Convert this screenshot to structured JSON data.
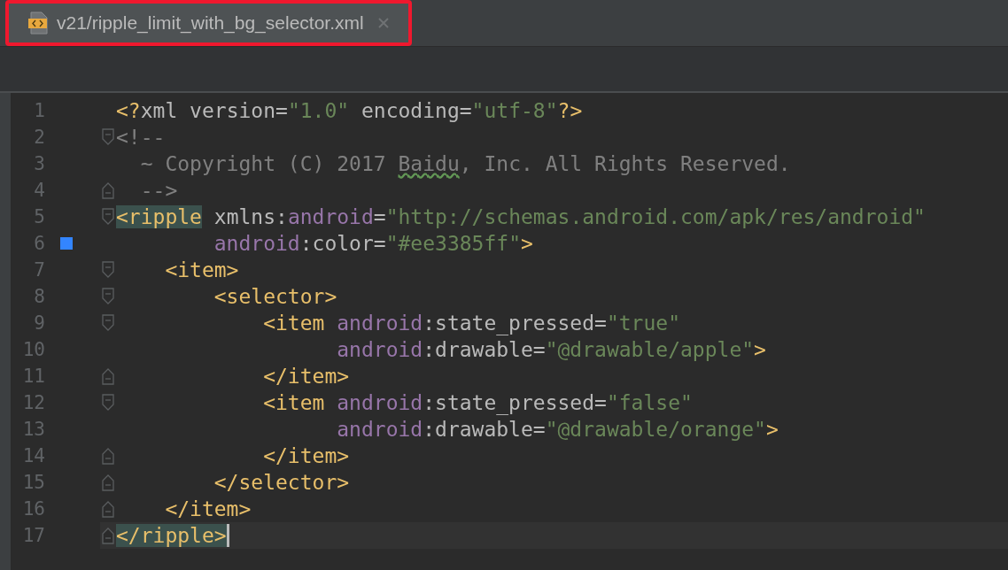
{
  "tabs": [
    {
      "label": "v21/ripple_limit_with_bg_selector.xml",
      "selected": true
    }
  ],
  "lines": [
    {
      "number": "1",
      "fold_start": false,
      "fold_end": false,
      "tokens": [
        {
          "kind": "tag",
          "text": "<?"
        },
        {
          "kind": "attr",
          "text": "xml version="
        },
        {
          "kind": "value",
          "text": "\"1.0\""
        },
        {
          "kind": "attr",
          "text": " encoding="
        },
        {
          "kind": "value",
          "text": "\"utf-8\""
        },
        {
          "kind": "tag",
          "text": "?>"
        }
      ]
    },
    {
      "number": "2",
      "fold_start": true,
      "fold_end": false,
      "tokens": [
        {
          "kind": "comment",
          "text": "<!--"
        }
      ]
    },
    {
      "number": "3",
      "fold_start": false,
      "fold_end": false,
      "tokens": [
        {
          "kind": "comment",
          "text": "  ~ Copyright (C) 2017 "
        },
        {
          "kind": "comment",
          "text": "Baidu",
          "misspelled": true
        },
        {
          "kind": "comment",
          "text": ", Inc. All Rights Reserved."
        }
      ]
    },
    {
      "number": "4",
      "fold_start": false,
      "fold_end": true,
      "tokens": [
        {
          "kind": "comment",
          "text": "  -->"
        }
      ]
    },
    {
      "number": "5",
      "fold_start": true,
      "fold_end": false,
      "tokens": [
        {
          "kind": "tag",
          "text": "<ripple",
          "matched": true
        },
        {
          "kind": "attr",
          "text": " xmlns:"
        },
        {
          "kind": "ns",
          "text": "android"
        },
        {
          "kind": "attr",
          "text": "="
        },
        {
          "kind": "value",
          "text": "\"http://schemas.android.com/apk/res/android\""
        }
      ]
    },
    {
      "number": "6",
      "fold_start": false,
      "fold_end": false,
      "color": "#3385ff",
      "tokens": [
        {
          "kind": "ns",
          "text": "        android"
        },
        {
          "kind": "attr",
          "text": ":color="
        },
        {
          "kind": "value",
          "text": "\"#ee3385ff\""
        },
        {
          "kind": "tag",
          "text": ">"
        }
      ]
    },
    {
      "number": "7",
      "fold_start": true,
      "fold_end": false,
      "tokens": [
        {
          "kind": "tag",
          "text": "    <item>"
        }
      ]
    },
    {
      "number": "8",
      "fold_start": true,
      "fold_end": false,
      "tokens": [
        {
          "kind": "tag",
          "text": "        <selector>"
        }
      ]
    },
    {
      "number": "9",
      "fold_start": true,
      "fold_end": false,
      "tokens": [
        {
          "kind": "tag",
          "text": "            <item "
        },
        {
          "kind": "ns",
          "text": "android"
        },
        {
          "kind": "attr",
          "text": ":state_pressed="
        },
        {
          "kind": "value",
          "text": "\"true\""
        }
      ]
    },
    {
      "number": "10",
      "fold_start": false,
      "fold_end": false,
      "tokens": [
        {
          "kind": "ns",
          "text": "                  android"
        },
        {
          "kind": "attr",
          "text": ":drawable="
        },
        {
          "kind": "value",
          "text": "\"@drawable/apple\""
        },
        {
          "kind": "tag",
          "text": ">"
        }
      ]
    },
    {
      "number": "11",
      "fold_start": false,
      "fold_end": true,
      "tokens": [
        {
          "kind": "tag",
          "text": "            </item>"
        }
      ]
    },
    {
      "number": "12",
      "fold_start": true,
      "fold_end": false,
      "tokens": [
        {
          "kind": "tag",
          "text": "            <item "
        },
        {
          "kind": "ns",
          "text": "android"
        },
        {
          "kind": "attr",
          "text": ":state_pressed="
        },
        {
          "kind": "value",
          "text": "\"false\""
        }
      ]
    },
    {
      "number": "13",
      "fold_start": false,
      "fold_end": false,
      "tokens": [
        {
          "kind": "ns",
          "text": "                  android"
        },
        {
          "kind": "attr",
          "text": ":drawable="
        },
        {
          "kind": "value",
          "text": "\"@drawable/orange\""
        },
        {
          "kind": "tag",
          "text": ">"
        }
      ]
    },
    {
      "number": "14",
      "fold_start": false,
      "fold_end": true,
      "tokens": [
        {
          "kind": "tag",
          "text": "            </item>"
        }
      ]
    },
    {
      "number": "15",
      "fold_start": false,
      "fold_end": true,
      "tokens": [
        {
          "kind": "tag",
          "text": "        </selector>"
        }
      ]
    },
    {
      "number": "16",
      "fold_start": false,
      "fold_end": true,
      "tokens": [
        {
          "kind": "tag",
          "text": "    </item>"
        }
      ]
    },
    {
      "number": "17",
      "fold_start": false,
      "fold_end": true,
      "current": true,
      "tokens": [
        {
          "kind": "tag",
          "text": "</ripple>",
          "matched": true
        }
      ]
    }
  ]
}
